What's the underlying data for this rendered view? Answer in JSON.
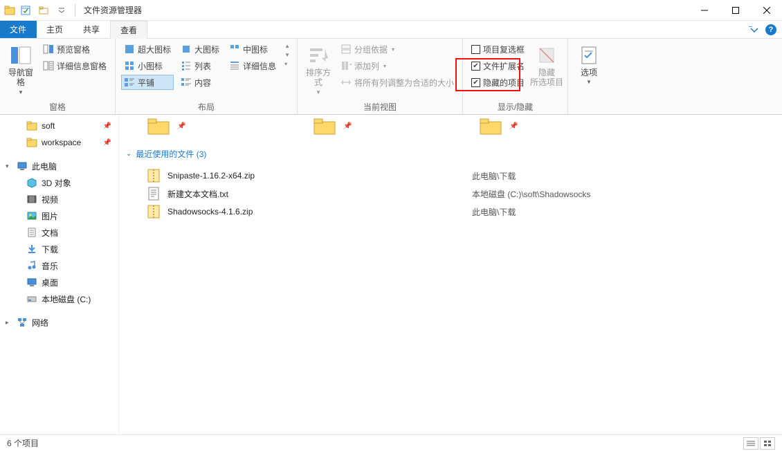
{
  "window": {
    "title": "文件资源管理器"
  },
  "tabs": {
    "file": "文件",
    "home": "主页",
    "share": "共享",
    "view": "查看"
  },
  "ribbon": {
    "group_panes": {
      "label": "窗格",
      "nav_pane": "导航窗格",
      "preview_pane": "预览窗格",
      "details_pane": "详细信息窗格"
    },
    "group_layout": {
      "label": "布局",
      "extra_large": "超大图标",
      "large": "大图标",
      "medium": "中图标",
      "small": "小图标",
      "list": "列表",
      "details": "详细信息",
      "tiles": "平铺",
      "content": "内容"
    },
    "group_current_view": {
      "label": "当前视图",
      "sort_by": "排序方式",
      "group_by": "分组依据",
      "add_columns": "添加列",
      "size_all": "将所有列调整为合适的大小"
    },
    "group_show_hide": {
      "label": "显示/隐藏",
      "item_checkboxes": "项目复选框",
      "file_ext": "文件扩展名",
      "hidden_items": "隐藏的项目",
      "hide_selected": "隐藏\n所选项目"
    },
    "group_options": {
      "options": "选项"
    }
  },
  "nav": {
    "soft": "soft",
    "workspace": "workspace",
    "this_pc": "此电脑",
    "objects_3d": "3D 对象",
    "videos": "视频",
    "pictures": "图片",
    "documents": "文档",
    "downloads": "下载",
    "music": "音乐",
    "desktop": "桌面",
    "local_disk": "本地磁盘 (C:)",
    "network": "网络"
  },
  "main": {
    "recent_header": "最近使用的文件 (3)",
    "files": [
      {
        "name": "Snipaste-1.16.2-x64.zip",
        "path": "此电脑\\下载",
        "type": "zip"
      },
      {
        "name": "新建文本文档.txt",
        "path": "本地磁盘 (C:)\\soft\\Shadowsocks",
        "type": "txt"
      },
      {
        "name": "Shadowsocks-4.1.6.zip",
        "path": "此电脑\\下载",
        "type": "zip"
      }
    ]
  },
  "statusbar": {
    "item_count": "6 个项目"
  }
}
